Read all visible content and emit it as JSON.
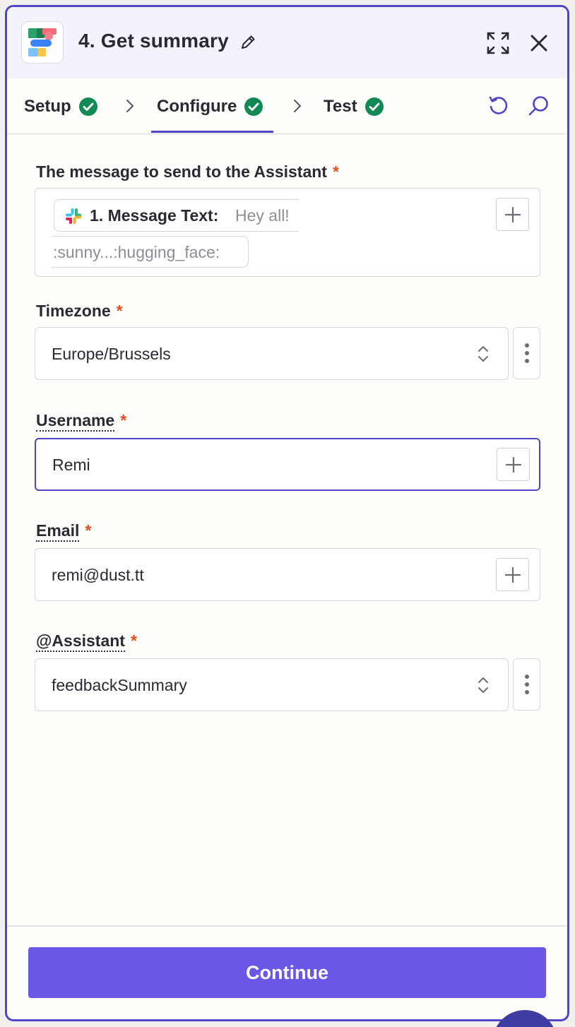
{
  "header": {
    "title": "4. Get summary",
    "app_icon": "dust-logo-icon"
  },
  "tabs": [
    {
      "label": "Setup",
      "complete": true
    },
    {
      "label": "Configure",
      "complete": true,
      "active": true
    },
    {
      "label": "Test",
      "complete": true
    }
  ],
  "fields": {
    "message": {
      "label": "The message to send to the Assistant",
      "required_mark": "*",
      "pill_source": "1. Message Text:",
      "pill_value": "Hey all!",
      "pill_value_cont": ":sunny...:hugging_face:"
    },
    "timezone": {
      "label": "Timezone",
      "required_mark": "*",
      "value": "Europe/Brussels"
    },
    "username": {
      "label": "Username",
      "required_mark": "*",
      "value": "Remi"
    },
    "email": {
      "label": "Email",
      "required_mark": "*",
      "value": "remi@dust.tt"
    },
    "assistant": {
      "label": "@Assistant",
      "required_mark": "*",
      "value": "feedbackSummary"
    }
  },
  "footer": {
    "continue_label": "Continue"
  },
  "colors": {
    "accent": "#5046c4",
    "button": "#6a57e6",
    "success": "#138a55",
    "required": "#e0501f"
  }
}
